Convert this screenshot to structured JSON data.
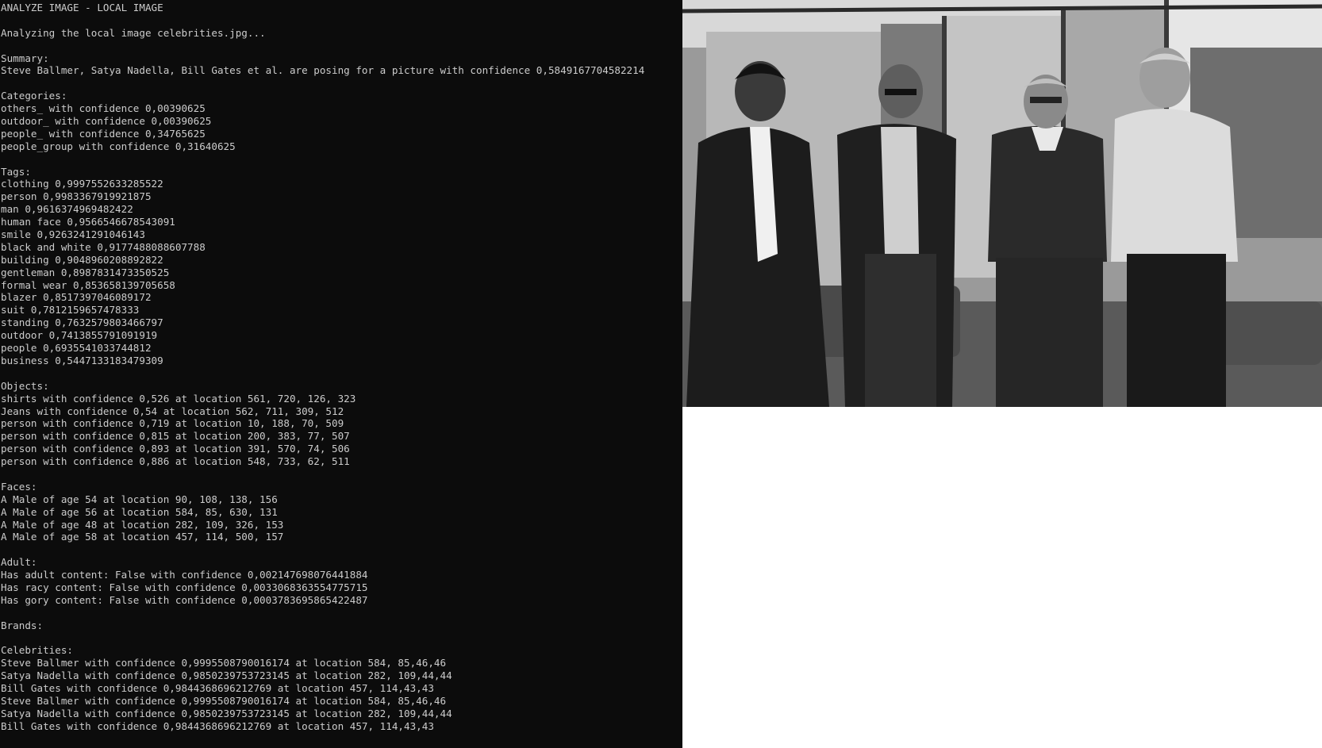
{
  "console": {
    "lines": [
      "ANALYZE IMAGE - LOCAL IMAGE",
      "",
      "Analyzing the local image celebrities.jpg...",
      "",
      "Summary:",
      "Steve Ballmer, Satya Nadella, Bill Gates et al. are posing for a picture with confidence 0,5849167704582214",
      "",
      "Categories:",
      "others_ with confidence 0,00390625",
      "outdoor_ with confidence 0,00390625",
      "people_ with confidence 0,34765625",
      "people_group with confidence 0,31640625",
      "",
      "Tags:",
      "clothing 0,9997552633285522",
      "person 0,9983367919921875",
      "man 0,9616374969482422",
      "human face 0,9566546678543091",
      "smile 0,9263241291046143",
      "black and white 0,9177488088607788",
      "building 0,9048960208892822",
      "gentleman 0,8987831473350525",
      "formal wear 0,853658139705658",
      "blazer 0,8517397046089172",
      "suit 0,7812159657478333",
      "standing 0,7632579803466797",
      "outdoor 0,7413855791091919",
      "people 0,6935541033744812",
      "business 0,5447133183479309",
      "",
      "Objects:",
      "shirts with confidence 0,526 at location 561, 720, 126, 323",
      "Jeans with confidence 0,54 at location 562, 711, 309, 512",
      "person with confidence 0,719 at location 10, 188, 70, 509",
      "person with confidence 0,815 at location 200, 383, 77, 507",
      "person with confidence 0,893 at location 391, 570, 74, 506",
      "person with confidence 0,886 at location 548, 733, 62, 511",
      "",
      "Faces:",
      "A Male of age 54 at location 90, 108, 138, 156",
      "A Male of age 56 at location 584, 85, 630, 131",
      "A Male of age 48 at location 282, 109, 326, 153",
      "A Male of age 58 at location 457, 114, 500, 157",
      "",
      "Adult:",
      "Has adult content: False with confidence 0,002147698076441884",
      "Has racy content: False with confidence 0,0033068363554775715",
      "Has gory content: False with confidence 0,0003783695865422487",
      "",
      "Brands:",
      "",
      "Celebrities:",
      "Steve Ballmer with confidence 0,9995508790016174 at location 584, 85,46,46",
      "Satya Nadella with confidence 0,9850239753723145 at location 282, 109,44,44",
      "Bill Gates with confidence 0,9844368696212769 at location 457, 114,43,43",
      "Steve Ballmer with confidence 0,9995508790016174 at location 584, 85,46,46",
      "Satya Nadella with confidence 0,9850239753723145 at location 282, 109,44,44",
      "Bill Gates with confidence 0,9844368696212769 at location 457, 114,43,43"
    ]
  },
  "photo": {
    "subject": "black-and-white group photo of four men in front of a glass building"
  },
  "colors": {
    "console_bg": "#0c0c0c",
    "console_text": "#cccccc"
  }
}
